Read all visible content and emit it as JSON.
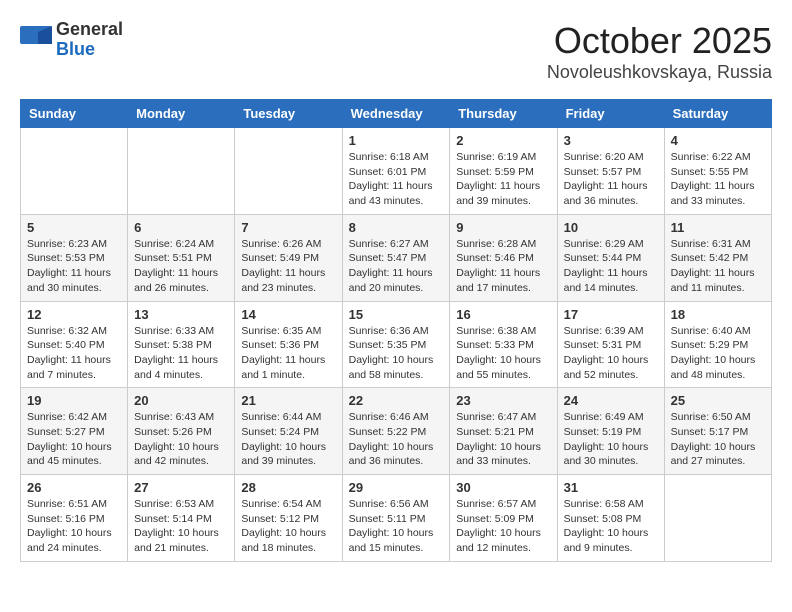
{
  "header": {
    "logo_general": "General",
    "logo_blue": "Blue",
    "month_title": "October 2025",
    "location": "Novoleushkovskaya, Russia"
  },
  "weekdays": [
    "Sunday",
    "Monday",
    "Tuesday",
    "Wednesday",
    "Thursday",
    "Friday",
    "Saturday"
  ],
  "weeks": [
    [
      {
        "day": "",
        "info": ""
      },
      {
        "day": "",
        "info": ""
      },
      {
        "day": "",
        "info": ""
      },
      {
        "day": "1",
        "info": "Sunrise: 6:18 AM\nSunset: 6:01 PM\nDaylight: 11 hours and 43 minutes."
      },
      {
        "day": "2",
        "info": "Sunrise: 6:19 AM\nSunset: 5:59 PM\nDaylight: 11 hours and 39 minutes."
      },
      {
        "day": "3",
        "info": "Sunrise: 6:20 AM\nSunset: 5:57 PM\nDaylight: 11 hours and 36 minutes."
      },
      {
        "day": "4",
        "info": "Sunrise: 6:22 AM\nSunset: 5:55 PM\nDaylight: 11 hours and 33 minutes."
      }
    ],
    [
      {
        "day": "5",
        "info": "Sunrise: 6:23 AM\nSunset: 5:53 PM\nDaylight: 11 hours and 30 minutes."
      },
      {
        "day": "6",
        "info": "Sunrise: 6:24 AM\nSunset: 5:51 PM\nDaylight: 11 hours and 26 minutes."
      },
      {
        "day": "7",
        "info": "Sunrise: 6:26 AM\nSunset: 5:49 PM\nDaylight: 11 hours and 23 minutes."
      },
      {
        "day": "8",
        "info": "Sunrise: 6:27 AM\nSunset: 5:47 PM\nDaylight: 11 hours and 20 minutes."
      },
      {
        "day": "9",
        "info": "Sunrise: 6:28 AM\nSunset: 5:46 PM\nDaylight: 11 hours and 17 minutes."
      },
      {
        "day": "10",
        "info": "Sunrise: 6:29 AM\nSunset: 5:44 PM\nDaylight: 11 hours and 14 minutes."
      },
      {
        "day": "11",
        "info": "Sunrise: 6:31 AM\nSunset: 5:42 PM\nDaylight: 11 hours and 11 minutes."
      }
    ],
    [
      {
        "day": "12",
        "info": "Sunrise: 6:32 AM\nSunset: 5:40 PM\nDaylight: 11 hours and 7 minutes."
      },
      {
        "day": "13",
        "info": "Sunrise: 6:33 AM\nSunset: 5:38 PM\nDaylight: 11 hours and 4 minutes."
      },
      {
        "day": "14",
        "info": "Sunrise: 6:35 AM\nSunset: 5:36 PM\nDaylight: 11 hours and 1 minute."
      },
      {
        "day": "15",
        "info": "Sunrise: 6:36 AM\nSunset: 5:35 PM\nDaylight: 10 hours and 58 minutes."
      },
      {
        "day": "16",
        "info": "Sunrise: 6:38 AM\nSunset: 5:33 PM\nDaylight: 10 hours and 55 minutes."
      },
      {
        "day": "17",
        "info": "Sunrise: 6:39 AM\nSunset: 5:31 PM\nDaylight: 10 hours and 52 minutes."
      },
      {
        "day": "18",
        "info": "Sunrise: 6:40 AM\nSunset: 5:29 PM\nDaylight: 10 hours and 48 minutes."
      }
    ],
    [
      {
        "day": "19",
        "info": "Sunrise: 6:42 AM\nSunset: 5:27 PM\nDaylight: 10 hours and 45 minutes."
      },
      {
        "day": "20",
        "info": "Sunrise: 6:43 AM\nSunset: 5:26 PM\nDaylight: 10 hours and 42 minutes."
      },
      {
        "day": "21",
        "info": "Sunrise: 6:44 AM\nSunset: 5:24 PM\nDaylight: 10 hours and 39 minutes."
      },
      {
        "day": "22",
        "info": "Sunrise: 6:46 AM\nSunset: 5:22 PM\nDaylight: 10 hours and 36 minutes."
      },
      {
        "day": "23",
        "info": "Sunrise: 6:47 AM\nSunset: 5:21 PM\nDaylight: 10 hours and 33 minutes."
      },
      {
        "day": "24",
        "info": "Sunrise: 6:49 AM\nSunset: 5:19 PM\nDaylight: 10 hours and 30 minutes."
      },
      {
        "day": "25",
        "info": "Sunrise: 6:50 AM\nSunset: 5:17 PM\nDaylight: 10 hours and 27 minutes."
      }
    ],
    [
      {
        "day": "26",
        "info": "Sunrise: 6:51 AM\nSunset: 5:16 PM\nDaylight: 10 hours and 24 minutes."
      },
      {
        "day": "27",
        "info": "Sunrise: 6:53 AM\nSunset: 5:14 PM\nDaylight: 10 hours and 21 minutes."
      },
      {
        "day": "28",
        "info": "Sunrise: 6:54 AM\nSunset: 5:12 PM\nDaylight: 10 hours and 18 minutes."
      },
      {
        "day": "29",
        "info": "Sunrise: 6:56 AM\nSunset: 5:11 PM\nDaylight: 10 hours and 15 minutes."
      },
      {
        "day": "30",
        "info": "Sunrise: 6:57 AM\nSunset: 5:09 PM\nDaylight: 10 hours and 12 minutes."
      },
      {
        "day": "31",
        "info": "Sunrise: 6:58 AM\nSunset: 5:08 PM\nDaylight: 10 hours and 9 minutes."
      },
      {
        "day": "",
        "info": ""
      }
    ]
  ]
}
